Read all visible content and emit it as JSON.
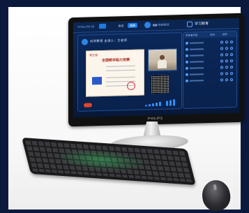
{
  "app": {
    "logo": "SYSLUTN 5E",
    "tabs": [
      "会议",
      "直播"
    ],
    "user_status": "▮▮▮ 在线会议",
    "header_title": "学习教育",
    "meeting_line": "向学教育  主讲人：王老师"
  },
  "certificate": {
    "stamp_title": "第五届",
    "title": "全国教学能力竞赛"
  },
  "side_panel": {
    "headers": [
      "参会者列表",
      "状态",
      "操作"
    ]
  },
  "monitor": {
    "brand": "PHILIPS"
  },
  "colors": {
    "accent": "#1e7be0",
    "screen_bg": "#0a2048",
    "frame": "#0b1a3c"
  }
}
